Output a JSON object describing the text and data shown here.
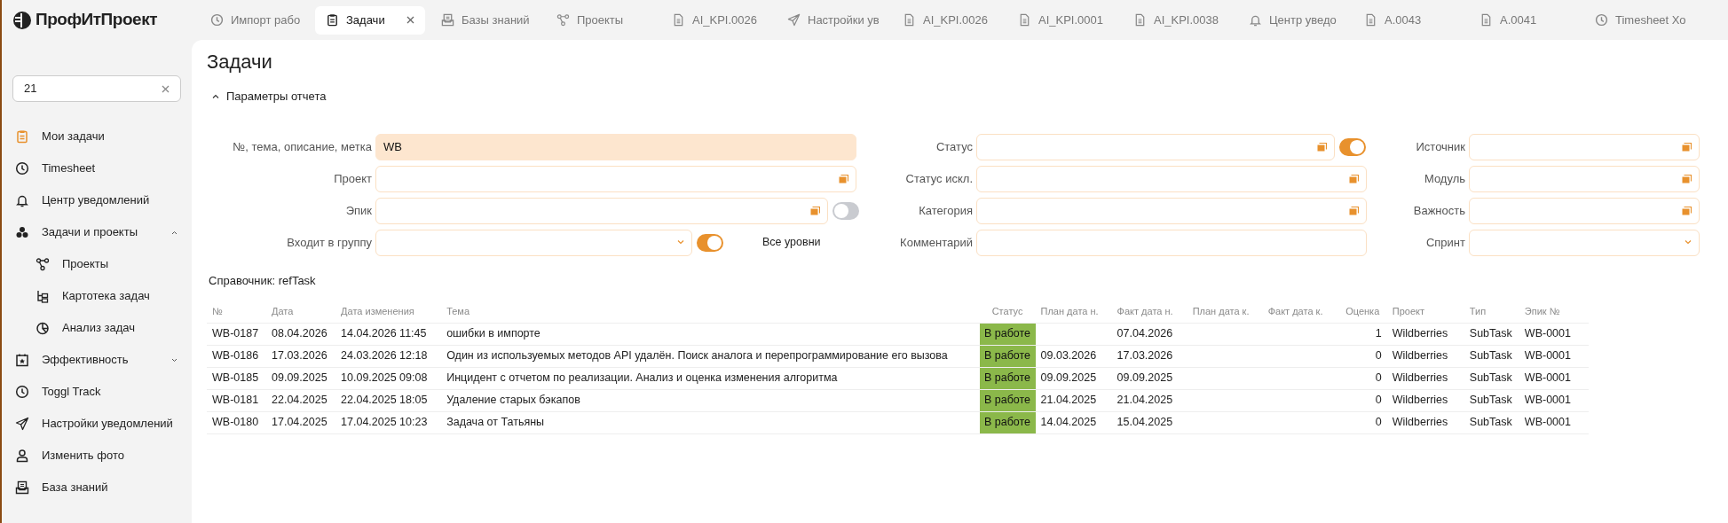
{
  "logo": "ПрофИтПроект",
  "tabs": [
    {
      "label": "Импорт рабо",
      "kind": "clock",
      "selected": false
    },
    {
      "label": "Задачи",
      "kind": "clipboard",
      "selected": true
    },
    {
      "label": "Базы знаний",
      "kind": "inbox",
      "selected": false
    },
    {
      "label": "Проекты",
      "kind": "nodes",
      "selected": false
    },
    {
      "label": "AI_KPI.0026",
      "kind": "doc",
      "selected": false
    },
    {
      "label": "Настройки ув",
      "kind": "plane",
      "selected": false
    },
    {
      "label": "AI_KPI.0026",
      "kind": "doc",
      "selected": false
    },
    {
      "label": "AI_KPI.0001",
      "kind": "doc",
      "selected": false
    },
    {
      "label": "AI_KPI.0038",
      "kind": "doc",
      "selected": false
    },
    {
      "label": "Центр уведо",
      "kind": "bell",
      "selected": false
    },
    {
      "label": "A.0043",
      "kind": "doc",
      "selected": false
    },
    {
      "label": "A.0041",
      "kind": "doc",
      "selected": false
    },
    {
      "label": "Timesheet Хо",
      "kind": "clock",
      "selected": false
    }
  ],
  "sidebar": {
    "search": {
      "value": "21"
    },
    "items": [
      {
        "label": "Мои задачи",
        "kind": "clipboard",
        "selected": true
      },
      {
        "label": "Timesheet",
        "kind": "clock",
        "selected": false
      },
      {
        "label": "Центр уведомлений",
        "kind": "bell",
        "selected": false
      },
      {
        "label": "Задачи и проекты",
        "kind": "cubes",
        "selected": false,
        "expanded": true,
        "children": [
          {
            "label": "Проекты",
            "kind": "nodes",
            "selected": false
          },
          {
            "label": "Картотека задач",
            "kind": "tree",
            "selected": false
          },
          {
            "label": "Анализ задач",
            "kind": "pie",
            "selected": false
          }
        ]
      },
      {
        "label": "Эффективность",
        "kind": "calendar",
        "selected": false,
        "expanded": false
      },
      {
        "label": "Toggl Track",
        "kind": "clock",
        "selected": false
      },
      {
        "label": "Настройки уведомлений",
        "kind": "plane",
        "selected": false
      },
      {
        "label": "Изменить фото",
        "kind": "user",
        "selected": false
      },
      {
        "label": "База знаний",
        "kind": "inbox",
        "selected": false
      }
    ]
  },
  "page_title": "Задачи",
  "parameters": {
    "label": "Параметры отчета",
    "expanded": true
  },
  "filter_columns": [
    [
      {
        "label": "№, тема, описание, метка",
        "kind": "text",
        "value": "WB",
        "highlighted": true
      },
      {
        "label": "Проект",
        "kind": "lookup",
        "highlighted": false
      },
      {
        "label": "Эпик",
        "kind": "lookup",
        "highlighted": false,
        "toggle_on": false
      },
      {
        "label": "Входит в группу",
        "kind": "select",
        "highlighted": false,
        "toggle_on": true,
        "toggle_label": "Все уровни"
      }
    ],
    [
      {
        "label": "Статус",
        "kind": "lookup",
        "highlighted": false,
        "toggle_on": true
      },
      {
        "label": "Статус искл.",
        "kind": "lookup",
        "highlighted": false
      },
      {
        "label": "Категория",
        "kind": "lookup",
        "highlighted": false
      },
      {
        "label": "Комментарий",
        "kind": "text",
        "highlighted": false
      }
    ],
    [
      {
        "label": "Источник",
        "kind": "lookup",
        "highlighted": false
      },
      {
        "label": "Модуль",
        "kind": "lookup",
        "highlighted": false
      },
      {
        "label": "Важность",
        "kind": "lookup",
        "highlighted": false
      },
      {
        "label": "Спринт",
        "kind": "select",
        "highlighted": false
      }
    ]
  ],
  "table": {
    "caption": "Справочник: refTask",
    "columns": [
      "№",
      "Дата",
      "Дата изменения",
      "Тема",
      "Статус",
      "План дата н.",
      "Факт дата н.",
      "План дата к.",
      "Факт дата к.",
      "Оценка",
      "Проект",
      "Тип",
      "Эпик №"
    ],
    "rows": [
      [
        "WB-0187",
        "08.04.2026",
        "14.04.2026 11:45",
        "ошибки в импорте",
        "В работе",
        null,
        "07.04.2026",
        null,
        null,
        "1",
        "Wildberries",
        "SubTask",
        "WB-0001"
      ],
      [
        "WB-0186",
        "17.03.2026",
        "24.03.2026 12:18",
        "Один из используемых методов API удалён. Поиск аналога и перепрограммирование его вызова",
        "В работе",
        "09.03.2026",
        "17.03.2026",
        null,
        null,
        "0",
        "Wildberries",
        "SubTask",
        "WB-0001"
      ],
      [
        "WB-0185",
        "09.09.2025",
        "10.09.2025 09:08",
        "Инцидент с отчетом по реализации. Анализ и оценка изменения алгоритма",
        "В работе",
        "09.09.2025",
        "09.09.2025",
        null,
        null,
        "0",
        "Wildberries",
        "SubTask",
        "WB-0001"
      ],
      [
        "WB-0181",
        "22.04.2025",
        "22.04.2025 18:05",
        "Удаление старых бэкапов",
        "В работе",
        "21.04.2025",
        "21.04.2025",
        null,
        null,
        "0",
        "Wildberries",
        "SubTask",
        "WB-0001"
      ],
      [
        "WB-0180",
        "17.04.2025",
        "17.04.2025 10:23",
        "Задача от Татьяны",
        "В работе",
        "14.04.2025",
        "15.04.2025",
        null,
        null,
        "0",
        "Wildberries",
        "SubTask",
        "WB-0001"
      ]
    ]
  }
}
